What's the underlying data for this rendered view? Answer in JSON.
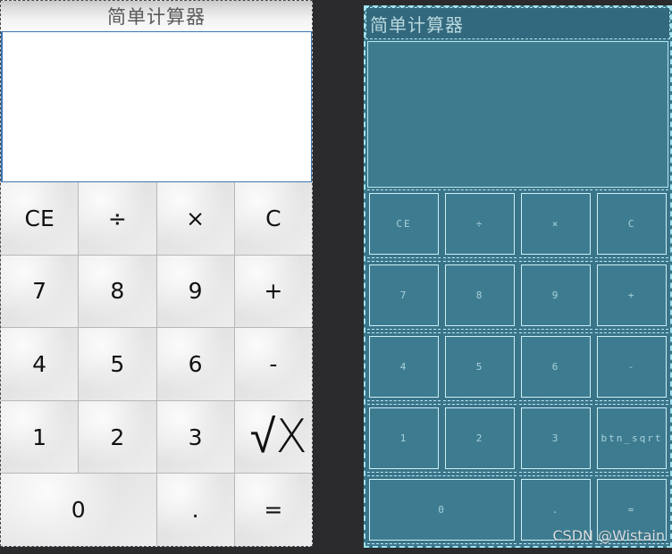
{
  "window": {
    "title": "简单计算器"
  },
  "left_panel": {
    "title": "简单计算器",
    "display": {
      "value": "",
      "placeholder": ""
    },
    "keys": [
      {
        "label": "CE",
        "name": "btn-ce"
      },
      {
        "label": "÷",
        "name": "btn-divide"
      },
      {
        "label": "×",
        "name": "btn-multiply"
      },
      {
        "label": "C",
        "name": "btn-c"
      },
      {
        "label": "7",
        "name": "btn-7"
      },
      {
        "label": "8",
        "name": "btn-8"
      },
      {
        "label": "9",
        "name": "btn-9"
      },
      {
        "label": "+",
        "name": "btn-plus"
      },
      {
        "label": "4",
        "name": "btn-4"
      },
      {
        "label": "5",
        "name": "btn-5"
      },
      {
        "label": "6",
        "name": "btn-6"
      },
      {
        "label": "-",
        "name": "btn-minus"
      },
      {
        "label": "1",
        "name": "btn-1"
      },
      {
        "label": "2",
        "name": "btn-2"
      },
      {
        "label": "3",
        "name": "btn-3"
      },
      {
        "label": "√X",
        "name": "btn-sqrt"
      },
      {
        "label": "0",
        "name": "btn-0"
      },
      {
        "label": ".",
        "name": "btn-decimal"
      },
      {
        "label": "=",
        "name": "btn-equals"
      }
    ]
  },
  "right_panel": {
    "title": "简单计算器",
    "display": {
      "value": ""
    },
    "keys": [
      {
        "label": "CE",
        "name": "wf-btn-ce"
      },
      {
        "label": "÷",
        "name": "wf-btn-divide"
      },
      {
        "label": "×",
        "name": "wf-btn-multiply"
      },
      {
        "label": "C",
        "name": "wf-btn-c"
      },
      {
        "label": "7",
        "name": "wf-btn-7"
      },
      {
        "label": "8",
        "name": "wf-btn-8"
      },
      {
        "label": "9",
        "name": "wf-btn-9"
      },
      {
        "label": "+",
        "name": "wf-btn-plus"
      },
      {
        "label": "4",
        "name": "wf-btn-4"
      },
      {
        "label": "5",
        "name": "wf-btn-5"
      },
      {
        "label": "6",
        "name": "wf-btn-6"
      },
      {
        "label": "-",
        "name": "wf-btn-minus"
      },
      {
        "label": "1",
        "name": "wf-btn-1"
      },
      {
        "label": "2",
        "name": "wf-btn-2"
      },
      {
        "label": "3",
        "name": "wf-btn-3"
      },
      {
        "label": "btn_sqrt",
        "name": "wf-btn-sqrt"
      },
      {
        "label": "0",
        "name": "wf-btn-0"
      },
      {
        "label": ".",
        "name": "wf-btn-decimal"
      },
      {
        "label": "=",
        "name": "wf-btn-equals"
      }
    ]
  },
  "watermark": {
    "text": "CSDN @Wistain"
  },
  "colors": {
    "background": "#2b2b2d",
    "left_key_face": "#e9e9e9",
    "left_display_border": "#3c78b4",
    "wireframe_fill": "#3a7489",
    "wireframe_line": "#bdecf5",
    "wireframe_titlebar": "#33697e",
    "wireframe_text": "#a9d2da"
  }
}
